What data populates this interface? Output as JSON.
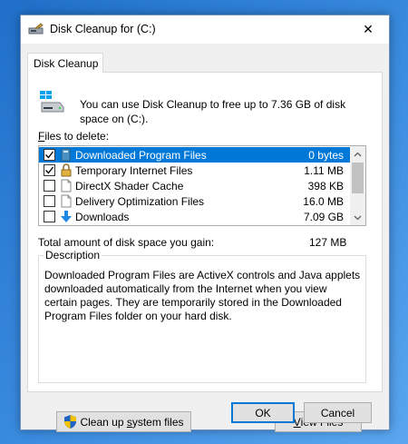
{
  "window": {
    "title": "Disk Cleanup for  (C:)",
    "close_glyph": "✕"
  },
  "tab": {
    "label": "Disk Cleanup"
  },
  "intro": {
    "text": "You can use Disk Cleanup to free up to 7.36 GB of disk space on (C:)."
  },
  "files": {
    "label_prefix": "F",
    "label_rest": "iles to delete:",
    "items": [
      {
        "name": "Downloaded Program Files",
        "size": "0 bytes",
        "checked": true,
        "selected": true,
        "icon": "folder-icon"
      },
      {
        "name": "Temporary Internet Files",
        "size": "1.11 MB",
        "checked": true,
        "selected": false,
        "icon": "lock-icon"
      },
      {
        "name": "DirectX Shader Cache",
        "size": "398 KB",
        "checked": false,
        "selected": false,
        "icon": "file-icon"
      },
      {
        "name": "Delivery Optimization Files",
        "size": "16.0 MB",
        "checked": false,
        "selected": false,
        "icon": "file-icon"
      },
      {
        "name": "Downloads",
        "size": "7.09 GB",
        "checked": false,
        "selected": false,
        "icon": "download-arrow-icon"
      }
    ]
  },
  "total": {
    "label": "Total amount of disk space you gain:",
    "value": "127 MB"
  },
  "description": {
    "legend": "Description",
    "text": "Downloaded Program Files are ActiveX controls and Java applets downloaded automatically from the Internet when you view certain pages. They are temporarily stored in the Downloaded Program Files folder on your hard disk."
  },
  "buttons": {
    "cleanup_a": "Clean up ",
    "cleanup_s": "s",
    "cleanup_b": "ystem files",
    "view_v": "V",
    "view_rest": "iew Files",
    "ok": "OK",
    "cancel": "Cancel"
  },
  "colors": {
    "selection": "#0078d7",
    "desktop": "#1f6fc9"
  }
}
